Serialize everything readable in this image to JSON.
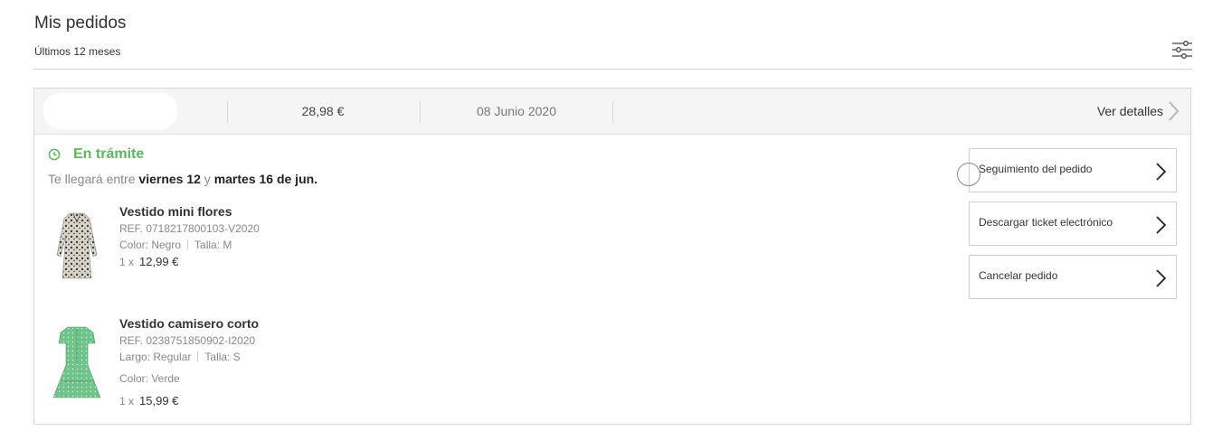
{
  "header": {
    "title": "Mis pedidos",
    "subtitle": "Últimos 12 meses",
    "filter_icon": "sliders-icon"
  },
  "order": {
    "total": "28,98 €",
    "date": "08 Junio 2020",
    "details_label": "Ver detalles",
    "status": "En trámite",
    "status_color": "#5cb85c",
    "delivery_prefix": "Te llegará entre",
    "delivery_from": "viernes 12",
    "delivery_join": "y",
    "delivery_to": "martes 16 de jun.",
    "products": [
      {
        "name": "Vestido mini flores",
        "ref": "REF. 0718217800103-V2020",
        "color": "Color: Negro",
        "size": "Talla: M",
        "qty": "1 x",
        "price": "12,99 €"
      },
      {
        "name": "Vestido camisero corto",
        "ref": "REF. 0238751850902-I2020",
        "length": "Largo: Regular",
        "size": "Talla: S",
        "color": "Color: Verde",
        "qty": "1 x",
        "price": "15,99 €"
      }
    ],
    "actions": [
      {
        "label": "Seguimiento del pedido"
      },
      {
        "label": "Descargar ticket electrónico"
      },
      {
        "label": "Cancelar pedido"
      }
    ]
  }
}
